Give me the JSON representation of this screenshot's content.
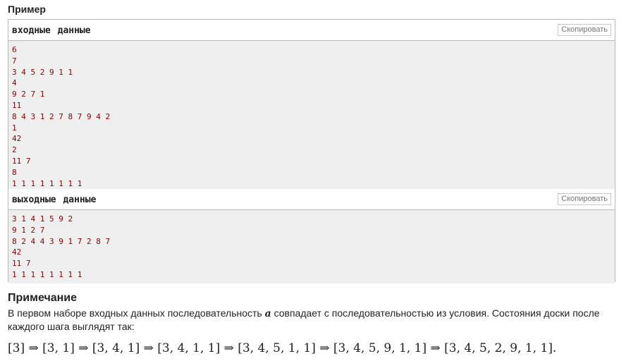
{
  "example": {
    "title": "Пример",
    "input": {
      "label": "входные  данные",
      "copy_label": "Скопировать",
      "lines": [
        "6",
        "7",
        "3 4 5 2 9 1 1",
        "4",
        "9 2 7 1",
        "11",
        "8 4 3 1 2 7 8 7 9 4 2",
        "1",
        "42",
        "2",
        "11 7",
        "8",
        "1 1 1 1 1 1 1 1"
      ]
    },
    "output": {
      "label": "выходные  данные",
      "copy_label": "Скопировать",
      "lines": [
        "3 1 4 1 5 9 2",
        "9 1 2 7",
        "8 2 4 4 3 9 1 7 2 8 7",
        "42",
        "11 7",
        "1 1 1 1 1 1 1 1"
      ]
    }
  },
  "note": {
    "title": "Примечание",
    "text_before": "В первом наборе входных данных последовательность ",
    "variable": "a",
    "text_after": " совпадает с последовательностью из условия. Состояния доски после каждого шага выглядят так:",
    "formula": "[3] ⇒ [3, 1] ⇒ [3, 4, 1] ⇒ [3, 4, 1, 1] ⇒ [3, 4, 5, 1, 1] ⇒ [3, 4, 5, 9, 1, 1] ⇒ [3, 4, 5, 2, 9, 1, 1]."
  }
}
